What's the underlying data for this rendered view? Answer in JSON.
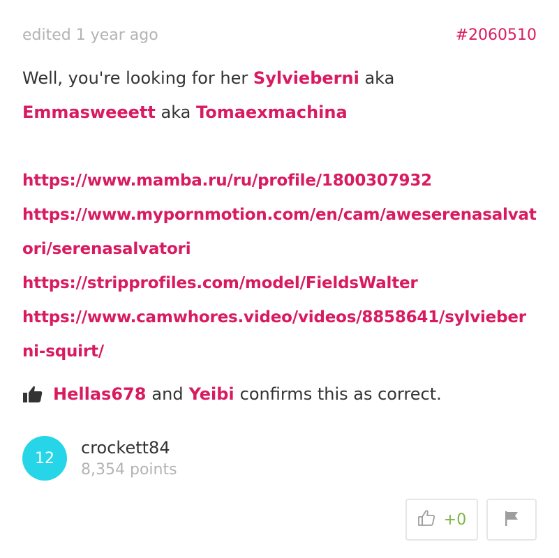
{
  "header": {
    "edited": "edited 1 year ago",
    "post_id": "#2060510"
  },
  "post": {
    "intro": "Well, you're looking for her",
    "aliases": [
      "Sylvieberni",
      "Emmasweeett",
      "Tomaexmachina"
    ],
    "aka": "aka",
    "links": [
      "https://www.mamba.ru/ru/profile/1800307932",
      "https://www.mypornmotion.com/en/cam/aweserenasalvatori/serenasalvatori",
      "https://stripprofiles.com/model/FieldsWalter",
      "https://www.camwhores.video/videos/8858641/sylvieberni-squirt/"
    ]
  },
  "confirmation": {
    "icon": "thumbs-up-icon",
    "users": [
      "Hellas678",
      "Yeibi"
    ],
    "and": "and",
    "text": "confirms this as correct."
  },
  "author": {
    "level": "12",
    "name": "crockett84",
    "points": "8,354 points",
    "avatar_color": "#26d6e8"
  },
  "actions": {
    "vote_count": "+0",
    "vote_icon": "thumbs-up-outline-icon",
    "flag_icon": "flag-icon"
  },
  "colors": {
    "accent": "#d81b60",
    "muted": "#b3b3b3",
    "positive": "#7cb342"
  }
}
